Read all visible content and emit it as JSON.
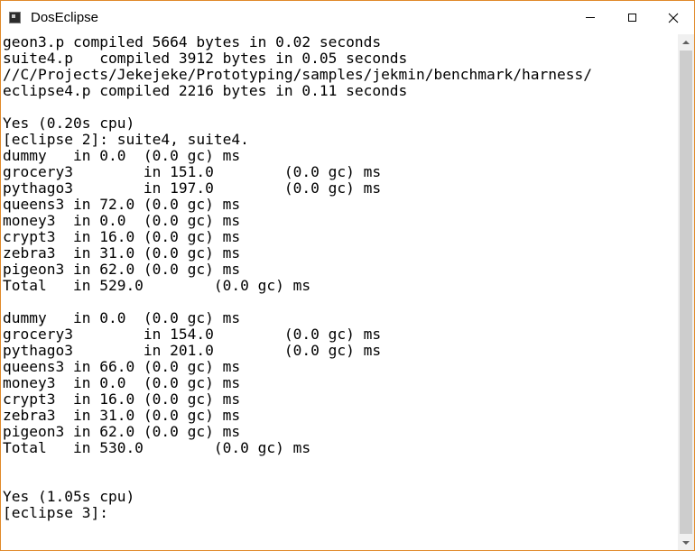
{
  "window": {
    "title": "DosEclipse"
  },
  "icons": {
    "app": "console-app-icon",
    "minimize": "minimize-icon",
    "maximize": "maximize-icon",
    "close": "close-icon",
    "scroll_up": "scroll-up-arrow-icon",
    "scroll_down": "scroll-down-arrow-icon"
  },
  "colors": {
    "frame_accent": "#e08a2a",
    "console_bg": "#ffffff",
    "console_text": "#000000"
  },
  "console": {
    "lines": [
      "geon3.p compiled 5664 bytes in 0.02 seconds",
      "suite4.p   compiled 3912 bytes in 0.05 seconds",
      "//C/Projects/Jekejeke/Prototyping/samples/jekmin/benchmark/harness/",
      "eclipse4.p compiled 2216 bytes in 0.11 seconds",
      "",
      "Yes (0.20s cpu)",
      "[eclipse 2]: suite4, suite4.",
      "dummy   in 0.0  (0.0 gc) ms",
      "grocery3        in 151.0        (0.0 gc) ms",
      "pythago3        in 197.0        (0.0 gc) ms",
      "queens3 in 72.0 (0.0 gc) ms",
      "money3  in 0.0  (0.0 gc) ms",
      "crypt3  in 16.0 (0.0 gc) ms",
      "zebra3  in 31.0 (0.0 gc) ms",
      "pigeon3 in 62.0 (0.0 gc) ms",
      "Total   in 529.0        (0.0 gc) ms",
      "",
      "dummy   in 0.0  (0.0 gc) ms",
      "grocery3        in 154.0        (0.0 gc) ms",
      "pythago3        in 201.0        (0.0 gc) ms",
      "queens3 in 66.0 (0.0 gc) ms",
      "money3  in 0.0  (0.0 gc) ms",
      "crypt3  in 16.0 (0.0 gc) ms",
      "zebra3  in 31.0 (0.0 gc) ms",
      "pigeon3 in 62.0 (0.0 gc) ms",
      "Total   in 530.0        (0.0 gc) ms",
      "",
      "",
      "Yes (1.05s cpu)",
      "[eclipse 3]:"
    ]
  }
}
